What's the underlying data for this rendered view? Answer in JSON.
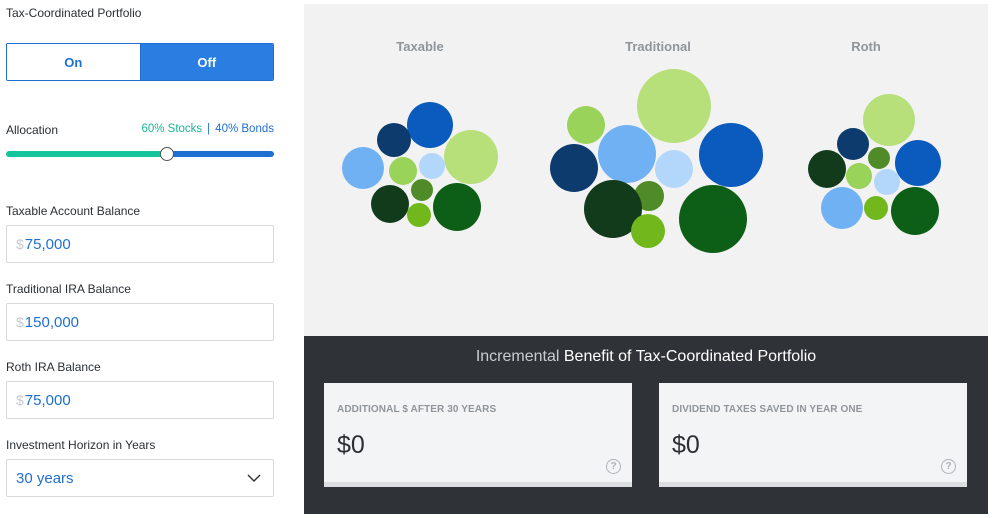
{
  "left": {
    "portfolio_label": "Tax-Coordinated Portfolio",
    "toggle": {
      "on_label": "On",
      "off_label": "Off",
      "selected": "Off"
    },
    "allocation": {
      "label": "Allocation",
      "stocks_label": "60% Stocks",
      "separator": "|",
      "bonds_label": "40% Bonds",
      "stocks_percent": 60
    },
    "taxable": {
      "label": "Taxable Account Balance",
      "currency": "$",
      "value": "75,000"
    },
    "traditional": {
      "label": "Traditional IRA Balance",
      "currency": "$",
      "value": "150,000"
    },
    "roth": {
      "label": "Roth IRA Balance",
      "currency": "$",
      "value": "75,000"
    },
    "horizon": {
      "label": "Investment Horizon in Years",
      "value": "30 years"
    }
  },
  "viz": {
    "titles": {
      "taxable": "Taxable",
      "traditional": "Traditional",
      "roth": "Roth"
    },
    "colors": {
      "navy": "#0d3b6e",
      "blue": "#0a5bbd",
      "sky": "#6fb1f3",
      "pale_sky": "#b3d7fb",
      "lime_light": "#b7e07a",
      "lime": "#99d35a",
      "olive": "#4f8c27",
      "bright_green": "#72b81c",
      "forest": "#0d5f17",
      "dark_forest": "#123b1b"
    }
  },
  "benefits": {
    "title_light": "Incremental",
    "title_strong": "Benefit of Tax-Coordinated Portfolio",
    "cards": [
      {
        "title": "ADDITIONAL $ AFTER 30 YEARS",
        "value": "$0",
        "help": "?"
      },
      {
        "title": "DIVIDEND TAXES SAVED IN YEAR ONE",
        "value": "$0",
        "help": "?"
      }
    ]
  }
}
